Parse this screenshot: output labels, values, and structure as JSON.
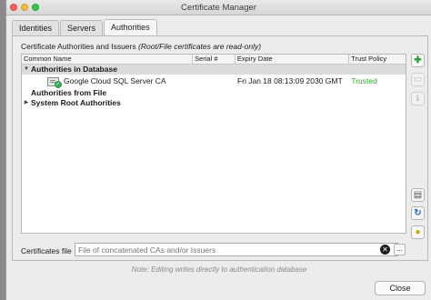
{
  "window": {
    "title": "Certificate Manager"
  },
  "tabs": [
    {
      "label": "Identities",
      "active": false
    },
    {
      "label": "Servers",
      "active": false
    },
    {
      "label": "Authorities",
      "active": true
    }
  ],
  "section": {
    "title": "Certificate Authorities and Issuers",
    "subtitle": "(Root/File certificates are read-only)"
  },
  "table": {
    "columns": [
      "Common Name",
      "Serial #",
      "Expiry Date",
      "Trust Policy"
    ],
    "groups": [
      {
        "label": "Authorities in Database",
        "expanded": true,
        "items": [
          {
            "common_name": "Google Cloud SQL Server CA",
            "serial": "",
            "expiry": "Fri Jan 18 08:13:09 2030 GMT",
            "trust": "Trusted"
          }
        ]
      },
      {
        "label": "Authorities from File",
        "expanded": false
      },
      {
        "label": "System Root Authorities",
        "expanded": false
      }
    ]
  },
  "side_buttons": {
    "add": "add-certificate-icon",
    "remove": "remove-icon",
    "info": "info-icon",
    "trust": "trust-policy-icon",
    "refresh": "refresh-icon",
    "import": "import-icon"
  },
  "file": {
    "label": "Certificates file",
    "placeholder": "File of concatenated CAs and/or Issuers",
    "clear_icon": "✕",
    "browse_label": "..."
  },
  "note": "Note: Editing writes directly to authentication database",
  "buttons": {
    "close": "Close"
  },
  "colors": {
    "trusted": "#2fa52f",
    "highlight": "#dcdcdc"
  }
}
